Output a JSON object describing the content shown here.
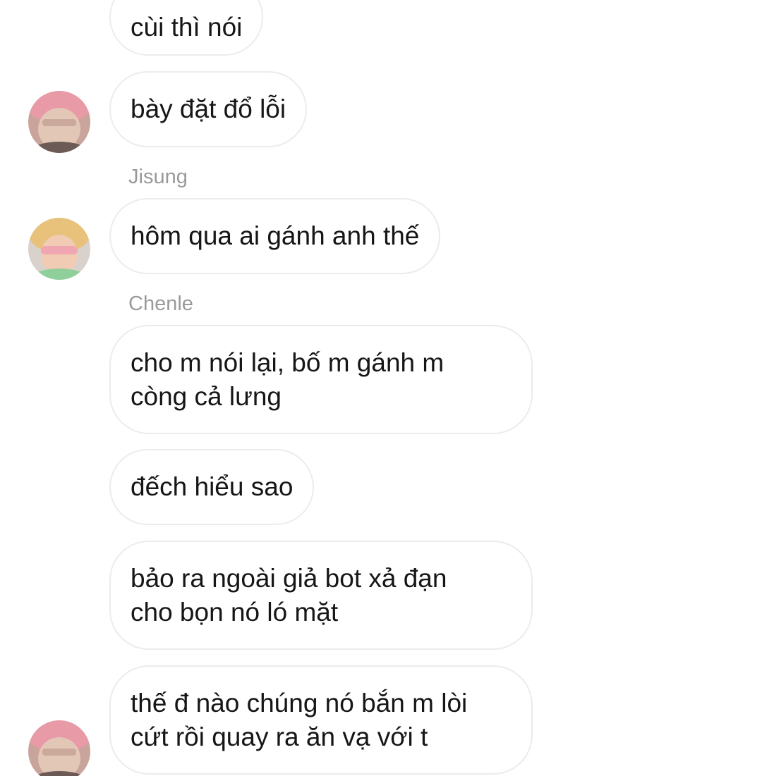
{
  "messages": [
    {
      "text": "cùi thì nói"
    },
    {
      "text": "bày đặt đổ lỗi"
    },
    {
      "sender": "Jisung",
      "text": "hôm qua ai gánh anh thế"
    },
    {
      "sender": "Chenle",
      "text": "cho m nói lại, bố m gánh m\ncòng cả lưng"
    },
    {
      "text": "đếch hiểu sao"
    },
    {
      "text": "bảo ra ngoài giả bot xả đạn\ncho bọn nó ló mặt"
    },
    {
      "text": "thế đ nào chúng nó bắn m lòi\ncứt rồi quay ra ăn vạ với t"
    }
  ],
  "avatars": {
    "pink_hair": "avatar-pink-hair-icon",
    "blonde_sunglasses": "avatar-blonde-sunglasses-icon"
  },
  "colors": {
    "bubble_border": "#ececec",
    "sender_name": "#9a9a9a",
    "message_text": "#161616"
  }
}
